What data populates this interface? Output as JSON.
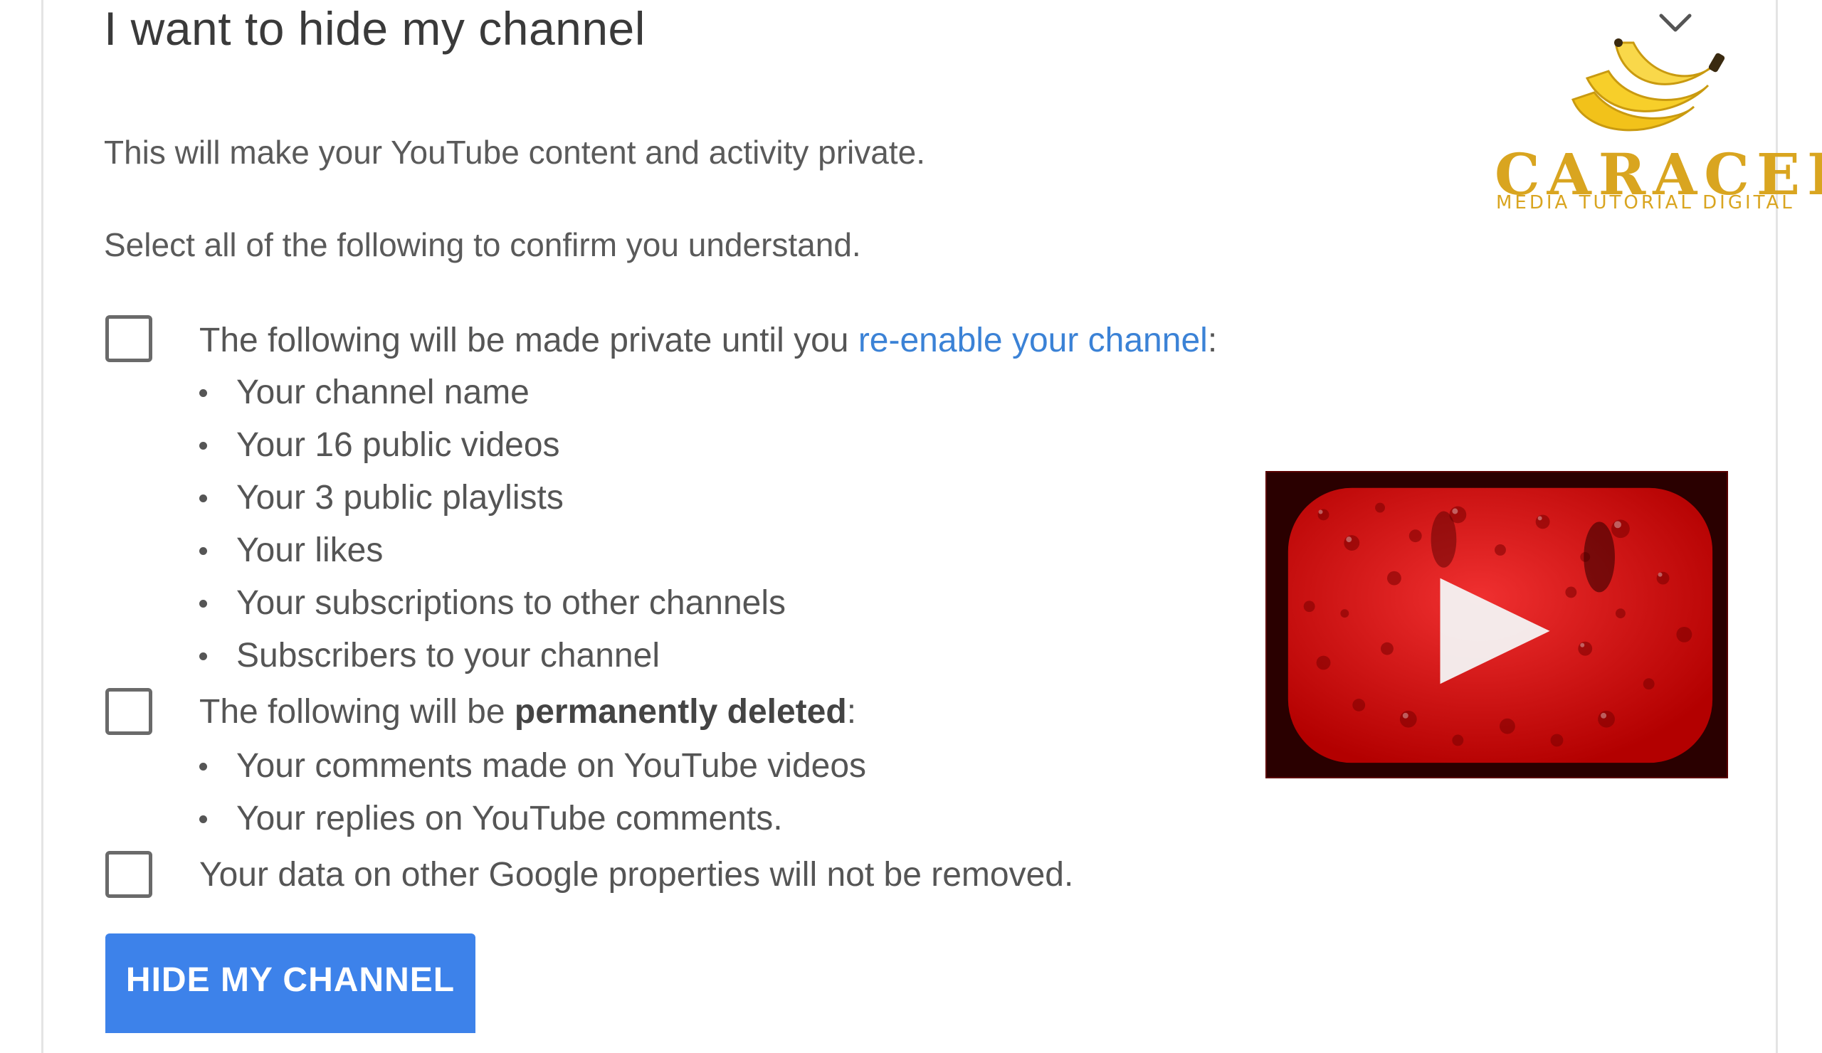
{
  "dialog": {
    "title": "I want to hide my channel",
    "intro": "This will make your YouTube content and activity private.",
    "instruction": "Select all of the following to confirm you understand.",
    "sections": [
      {
        "text_before": "The following will be made private until you ",
        "link_text": "re-enable your channel",
        "text_after": ":",
        "items": [
          "Your channel name",
          "Your 16 public videos",
          "Your 3 public playlists",
          "Your likes",
          "Your subscriptions to other channels",
          "Subscribers to your channel"
        ]
      },
      {
        "text_before": "The following will be ",
        "bold_text": "permanently deleted",
        "text_after": ":",
        "items": [
          "Your comments made on YouTube videos",
          "Your replies on YouTube comments."
        ]
      },
      {
        "text": "Your data on other Google properties will not be removed."
      }
    ],
    "hide_button": "HIDE MY CHANNEL"
  },
  "watermark": {
    "brand": "CARACEK",
    "tagline": "MEDIA TUTORIAL DIGITAL"
  },
  "colors": {
    "link": "#3b82d6",
    "button": "#3d82ea",
    "brand": "#d9a520",
    "youtube_red": "#d01010"
  },
  "icons": {
    "collapse": "chevron-down-icon",
    "image": "youtube-logo-water-drops"
  }
}
